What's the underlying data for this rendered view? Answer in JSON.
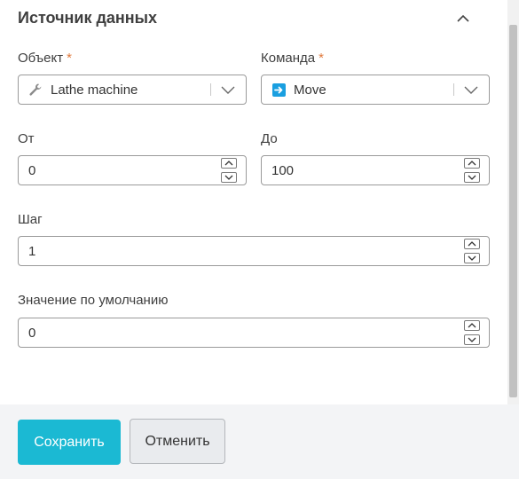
{
  "section": {
    "title": "Источник данных"
  },
  "object_field": {
    "label": "Объект",
    "required_mark": "*",
    "value": "Lathe machine",
    "icon": "wrench-icon"
  },
  "command_field": {
    "label": "Команда",
    "required_mark": "*",
    "value": "Move",
    "icon": "arrow-right-icon"
  },
  "from_field": {
    "label": "От",
    "value": "0"
  },
  "to_field": {
    "label": "До",
    "value": "100"
  },
  "step_field": {
    "label": "Шаг",
    "value": "1"
  },
  "default_field": {
    "label": "Значение по умолчанию",
    "value": "0"
  },
  "footer": {
    "save_label": "Сохранить",
    "cancel_label": "Отменить"
  },
  "colors": {
    "accent": "#1bb9d3",
    "required": "#e0783b",
    "command_icon_bg": "#1a9fe0"
  }
}
